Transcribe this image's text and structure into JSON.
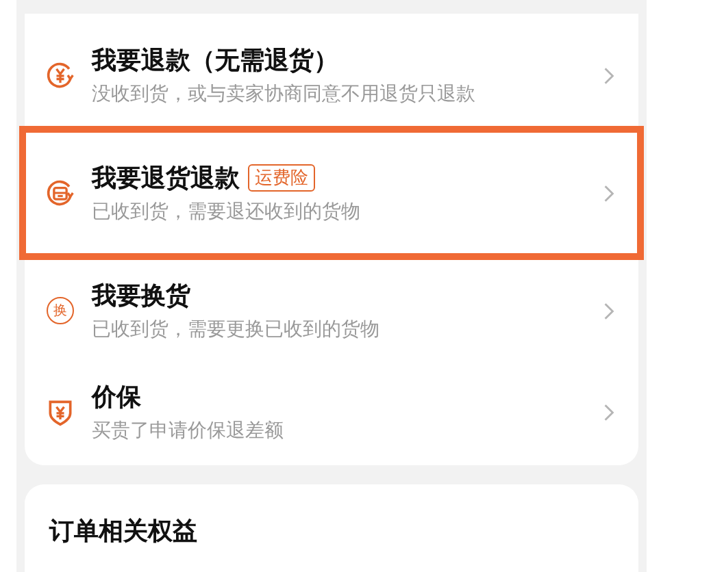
{
  "options": [
    {
      "kind": "refund",
      "title": "我要退款（无需退货）",
      "subtitle": "没收到货，或与卖家协商同意不用退货只退款",
      "highlighted": false
    },
    {
      "kind": "return",
      "title": "我要退货退款",
      "badge": "运费险",
      "subtitle": "已收到货，需要退还收到的货物",
      "highlighted": true
    },
    {
      "kind": "exchange",
      "icon_label": "换",
      "title": "我要换货",
      "subtitle": "已收到货，需要更换已收到的货物",
      "highlighted": false
    },
    {
      "kind": "protection",
      "title": "价保",
      "subtitle": "买贵了申请价保退差额",
      "highlighted": false
    }
  ],
  "section": {
    "title": "订单相关权益"
  }
}
